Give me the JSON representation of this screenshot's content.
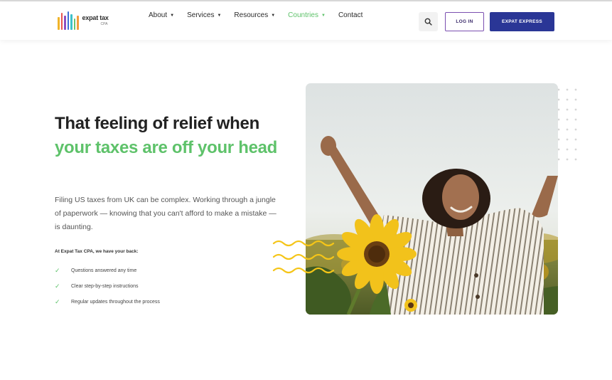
{
  "header": {
    "logo": {
      "wordmark": "expat tax",
      "sub": "CPA",
      "bar_colors": [
        "#f0b429",
        "#e8544e",
        "#8c4fc2",
        "#3d6fd6",
        "#3ec1c9",
        "#6cc36e",
        "#f39c3c"
      ],
      "icon": "logo-bars-icon"
    },
    "nav": [
      {
        "label": "About",
        "dropdown": true,
        "active": false
      },
      {
        "label": "Services",
        "dropdown": true,
        "active": false
      },
      {
        "label": "Resources",
        "dropdown": true,
        "active": false
      },
      {
        "label": "Countries",
        "dropdown": true,
        "active": true
      },
      {
        "label": "Contact",
        "dropdown": false,
        "active": false
      }
    ],
    "search_icon": "search-icon",
    "login_label": "LOG IN",
    "express_label": "EXPAT EXPRESS"
  },
  "hero": {
    "title_part1": "That feeling of relief when ",
    "title_highlight": "your taxes are off your head",
    "description": "Filing US taxes from UK can be complex. Working through a jungle of paperwork — knowing that you can't afford to make a mistake — is daunting.",
    "backed_text": "At Expat Tax CPA, we have your back:",
    "checklist": [
      "Questions answered any time",
      "Clear step-by-step instructions",
      "Regular updates throughout the process"
    ],
    "image_subject": "woman-with-raised-arms-in-sunflower-field"
  },
  "colors": {
    "accent_green": "#5ec26a",
    "brand_navy": "#2a3696",
    "login_border": "#7b4fb0",
    "wave_yellow": "#f5c518"
  }
}
